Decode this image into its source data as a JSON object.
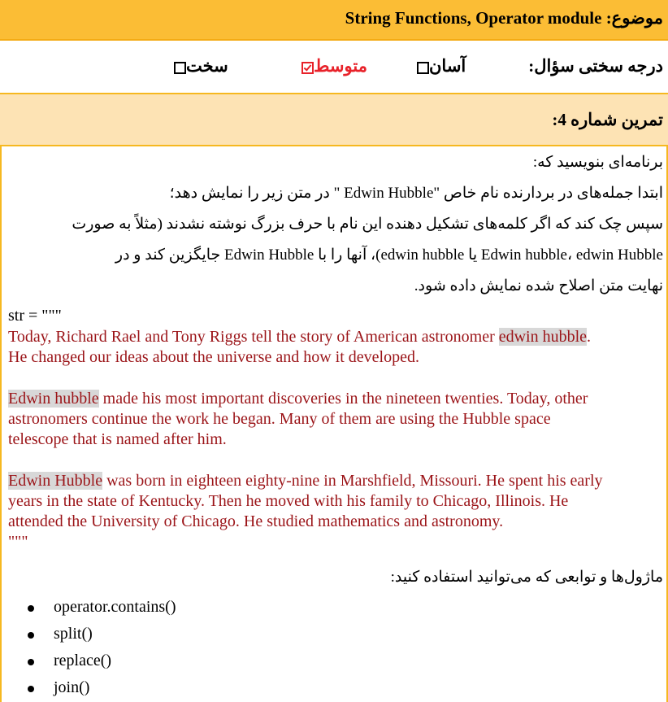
{
  "topic": {
    "label": "موضوع:",
    "value": "String Functions, Operator module"
  },
  "difficulty": {
    "label": "درجه سختی سؤال:",
    "easy": "آسان",
    "medium": "متوسط",
    "hard": "سخت",
    "selected": "medium"
  },
  "exercise": {
    "title": "تمرین شماره 4:"
  },
  "instructions": {
    "line1": "برنامه‌ای بنویسید که:",
    "line2": "ابتدا جمله‌های در بردارنده نام خاص \"Edwin Hubble \" در متن زیر را نمایش دهد؛",
    "line3": "سپس چک کند که اگر کلمه‌های تشکیل دهنده این نام با حرف بزرگ نوشته نشدند (مثلاً به صورت",
    "line4": "Edwin hubble، edwin Hubble یا edwin hubble)، آنها را با  Edwin Hubble  جایگزین کند و در",
    "line5": "نهایت متن اصلاح شده نمایش داده شود."
  },
  "code": {
    "open": "str = \"\"\"",
    "p1_line1_pre": "Today, Richard Rael and Tony Riggs tell the story of American astronomer ",
    "p1_line1_hl": "edwin hubble",
    "p1_line1_post": ".",
    "p1_line2": "He changed our ideas about the universe and how it developed.",
    "p2_line1_hl": "Edwin hubble",
    "p2_line1_post": " made his most important discoveries in the nineteen twenties. Today, other",
    "p2_line2": "astronomers continue the work he began. Many of them are using the Hubble space",
    "p2_line3": "telescope that is named after him.",
    "p3_line1_hl": "Edwin Hubble",
    "p3_line1_post": " was born in eighteen eighty-nine in Marshfield, Missouri. He spent his early",
    "p3_line2": "years in the state of Kentucky. Then he moved with his family to Chicago, Illinois. He",
    "p3_line3": "attended the University of Chicago. He studied mathematics and astronomy.",
    "close": "\"\"\""
  },
  "modules": {
    "label": "ماژول‌ها و توابعی که می‌توانید استفاده کنید:",
    "items": [
      "operator.contains()",
      "split()",
      "replace()",
      "join()"
    ]
  },
  "colors": {
    "header": "#fbbd35",
    "exercise_band": "#fde3b4",
    "border": "#f6b820",
    "text_red": "#9b1418",
    "selected_red": "#e8222a"
  }
}
